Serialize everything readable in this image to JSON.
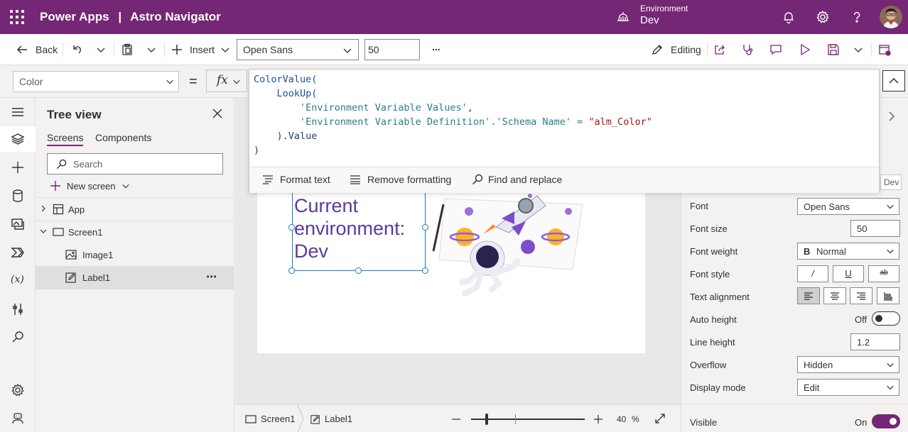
{
  "header": {
    "app_name": "Power Apps",
    "separator": "|",
    "app_title": "Astro Navigator",
    "environment_label": "Environment",
    "environment_value": "Dev"
  },
  "toolbar": {
    "back_label": "Back",
    "insert_label": "Insert",
    "font_value": "Open Sans",
    "font_size_value": "50",
    "more_label": "...",
    "editing_label": "Editing"
  },
  "formula_bar": {
    "property": "Color",
    "equals": "=",
    "fx": "fx",
    "code": {
      "l1_fn": "ColorValue(",
      "l2_fn": "LookUp(",
      "l3_str": "'Environment Variable Values'",
      "l3_comma": ",",
      "l4_a": "'Environment Variable Definition'.'Schema Name' = ",
      "l4_b": "\"alm_Color\"",
      "l5": ").Value",
      "l6": ")"
    },
    "format_text": "Format text",
    "remove_formatting": "Remove formatting",
    "find_replace": "Find and replace"
  },
  "tree": {
    "title": "Tree view",
    "tabs": [
      "Screens",
      "Components"
    ],
    "search_placeholder": "Search",
    "new_screen": "New screen",
    "nodes": [
      "App",
      "Screen1",
      "Image1",
      "Label1"
    ],
    "node_more": "⋯"
  },
  "canvas": {
    "label_text": "Current environment: Dev"
  },
  "statusbar": {
    "crumbs": [
      "Screen1",
      "Label1"
    ],
    "zoom": "40",
    "zoom_unit": "%",
    "zoom_level": 0.4
  },
  "properties": {
    "dev_badge": "Dev",
    "font_label": "Font",
    "font_value": "Open Sans",
    "font_size_label": "Font size",
    "font_size_value": "50",
    "font_weight_label": "Font weight",
    "font_weight_icon": "B",
    "font_weight_value": "Normal",
    "font_style_label": "Font style",
    "font_style_buttons": [
      "/",
      "U",
      "ab"
    ],
    "text_alignment_label": "Text alignment",
    "auto_height_label": "Auto height",
    "auto_height_value": "Off",
    "line_height_label": "Line height",
    "line_height_value": "1.2",
    "overflow_label": "Overflow",
    "overflow_value": "Hidden",
    "display_mode_label": "Display mode",
    "display_mode_value": "Edit",
    "visible_label": "Visible",
    "visible_value": "On"
  },
  "colors": {
    "brand": "#742774",
    "label_text": "#5b3a9a",
    "selection": "#1f78c8"
  }
}
